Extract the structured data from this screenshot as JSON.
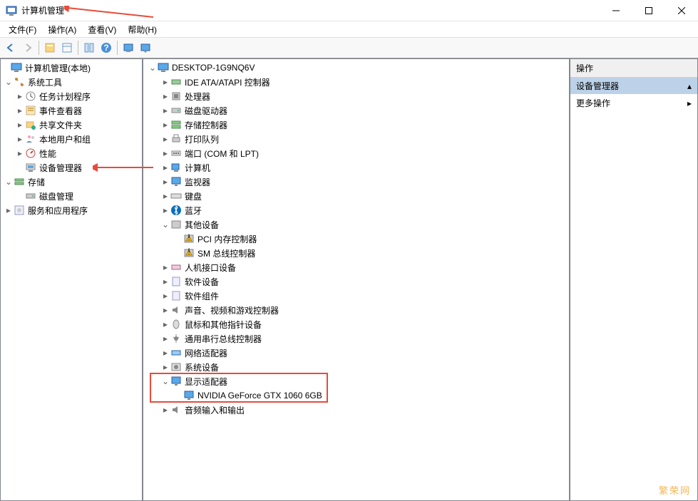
{
  "window": {
    "title": "计算机管理"
  },
  "menu": [
    "文件(F)",
    "操作(A)",
    "查看(V)",
    "帮助(H)"
  ],
  "left_tree": {
    "root": "计算机管理(本地)",
    "system_tools": "系统工具",
    "task_scheduler": "任务计划程序",
    "event_viewer": "事件查看器",
    "shared_folders": "共享文件夹",
    "local_users": "本地用户和组",
    "performance": "性能",
    "device_manager": "设备管理器",
    "storage": "存储",
    "disk_mgmt": "磁盘管理",
    "services_apps": "服务和应用程序"
  },
  "mid_tree": {
    "computer": "DESKTOP-1G9NQ6V",
    "ide": "IDE ATA/ATAPI 控制器",
    "cpu": "处理器",
    "disk_drives": "磁盘驱动器",
    "storage_ctrl": "存储控制器",
    "print_queues": "打印队列",
    "ports": "端口 (COM 和 LPT)",
    "computers": "计算机",
    "monitors": "监视器",
    "keyboards": "键盘",
    "bluetooth": "蓝牙",
    "other_devices": "其他设备",
    "pci_mem": "PCI 内存控制器",
    "sm_bus": "SM 总线控制器",
    "hid": "人机接口设备",
    "software_dev": "软件设备",
    "software_comp": "软件组件",
    "sound": "声音、视频和游戏控制器",
    "mouse": "鼠标和其他指针设备",
    "usb": "通用串行总线控制器",
    "network": "网络适配器",
    "system_dev": "系统设备",
    "display": "显示适配器",
    "gpu": "NVIDIA GeForce GTX 1060 6GB",
    "audio_io": "音频输入和输出"
  },
  "actions": {
    "header": "操作",
    "device_manager": "设备管理器",
    "more": "更多操作"
  },
  "watermark": "繁荣网"
}
